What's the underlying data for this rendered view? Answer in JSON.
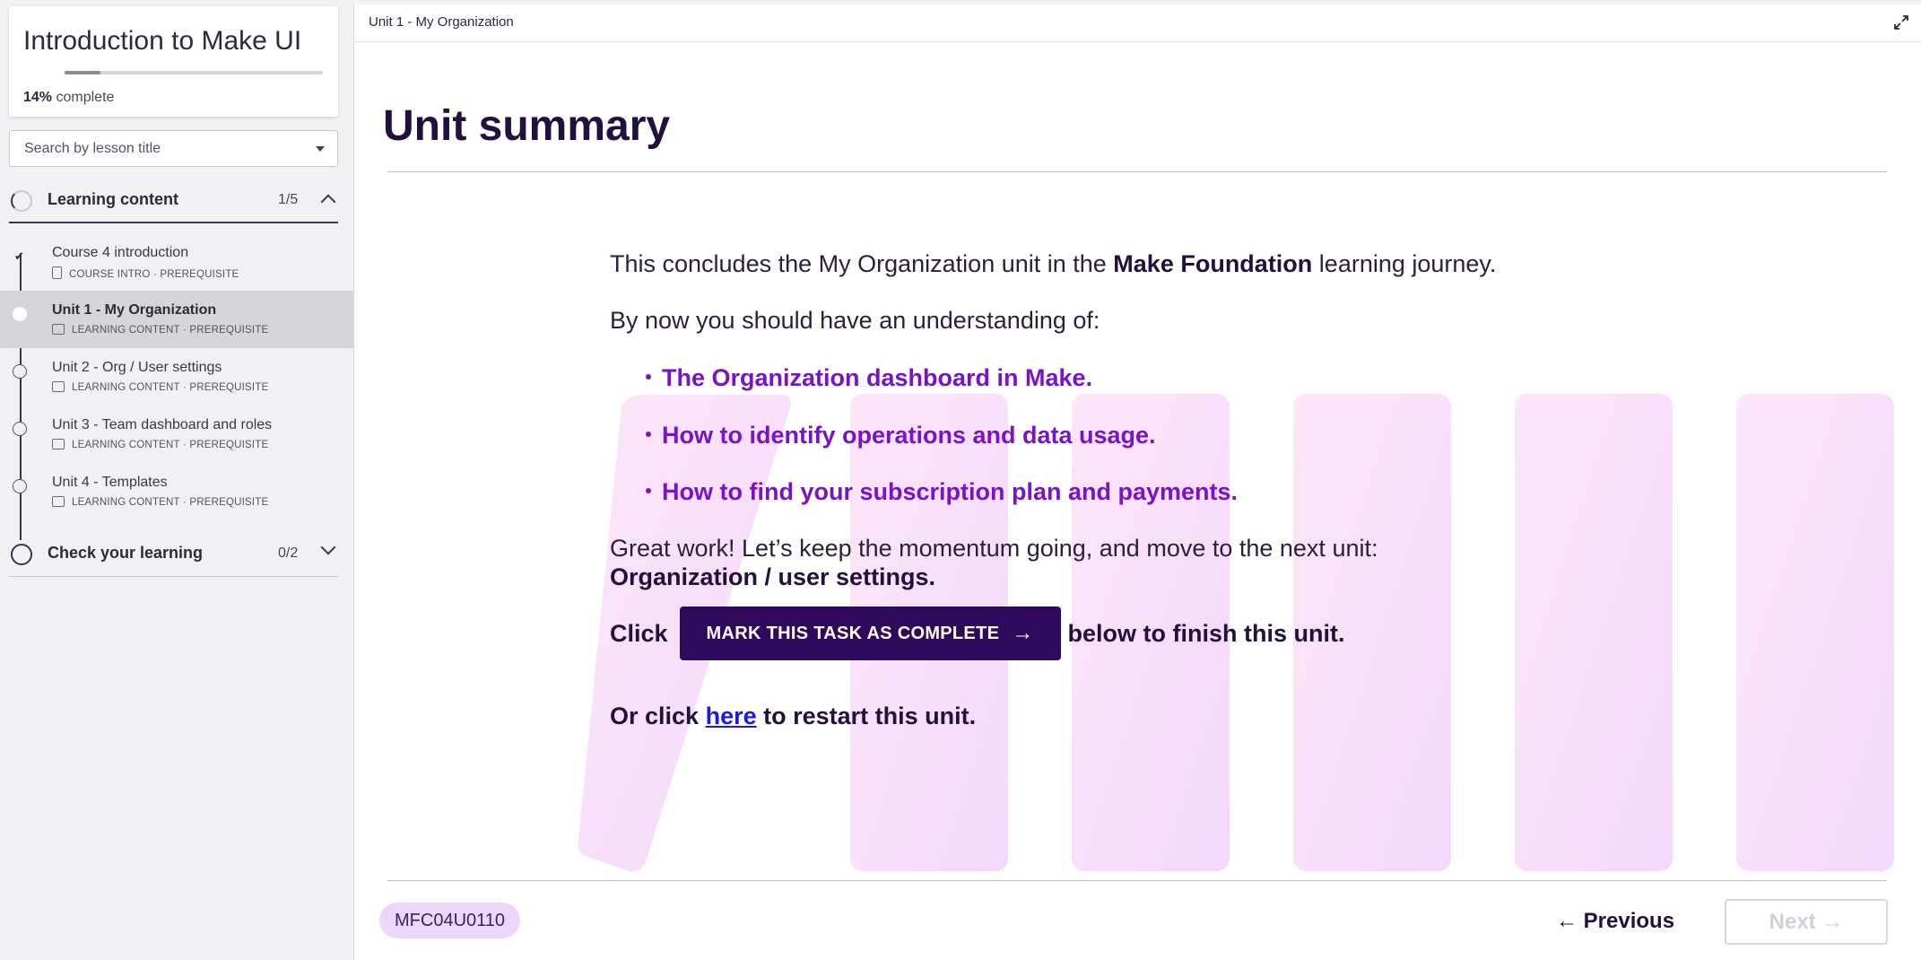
{
  "course": {
    "title": "Introduction to Make UI",
    "progress_value": "14%",
    "progress_suffix": "complete",
    "progress_fraction": 0.14
  },
  "search": {
    "placeholder": "Search by lesson title"
  },
  "sections": [
    {
      "label": "Learning content",
      "count": "1/5",
      "expanded": true
    },
    {
      "label": "Check your learning",
      "count": "0/2",
      "expanded": false
    }
  ],
  "lessons": [
    {
      "title": "Course 4 introduction",
      "meta": "COURSE INTRO · PREREQUISITE",
      "completed": true,
      "icon": "document-icon"
    },
    {
      "title": "Unit 1 - My Organization",
      "meta": "LEARNING CONTENT · PREREQUISITE",
      "active": true,
      "icon": "slides-icon"
    },
    {
      "title": "Unit 2 - Org / User settings",
      "meta": "LEARNING CONTENT · PREREQUISITE",
      "icon": "slides-icon"
    },
    {
      "title": "Unit 3 - Team dashboard and roles",
      "meta": "LEARNING CONTENT · PREREQUISITE",
      "icon": "slides-icon"
    },
    {
      "title": "Unit 4 - Templates",
      "meta": "LEARNING CONTENT · PREREQUISITE",
      "icon": "slides-icon"
    }
  ],
  "topbar": {
    "breadcrumb": "Unit 1 - My Organization",
    "expand_icon": "expand-icon"
  },
  "main": {
    "heading": "Unit summary",
    "intro_pre": "This concludes the My Organization unit in the ",
    "intro_bold": "Make Foundation",
    "intro_post": " learning journey.",
    "understanding": "By now you should have an understanding of:",
    "bullets": [
      "The Organization dashboard in Make.",
      "How to identify operations and data usage.",
      "How to find your subscription plan and payments."
    ],
    "great_work": "Great work! Let’s keep the momentum going, and move to the next unit:",
    "next_unit": "Organization / user settings.",
    "click_pre": "Click",
    "mark_button": "MARK THIS TASK AS COMPLETE",
    "click_post": "below to finish this unit.",
    "restart_pre": "Or click ",
    "restart_link": "here",
    "restart_post": " to restart this unit."
  },
  "footer": {
    "code": "MFC04U0110",
    "previous": "Previous",
    "next": "Next"
  },
  "colors": {
    "accent_purple": "#7a12c9",
    "button_dark": "#2f0a5c",
    "link_blue": "#1a1ae6",
    "badge_bg": "#ecd6fa"
  }
}
